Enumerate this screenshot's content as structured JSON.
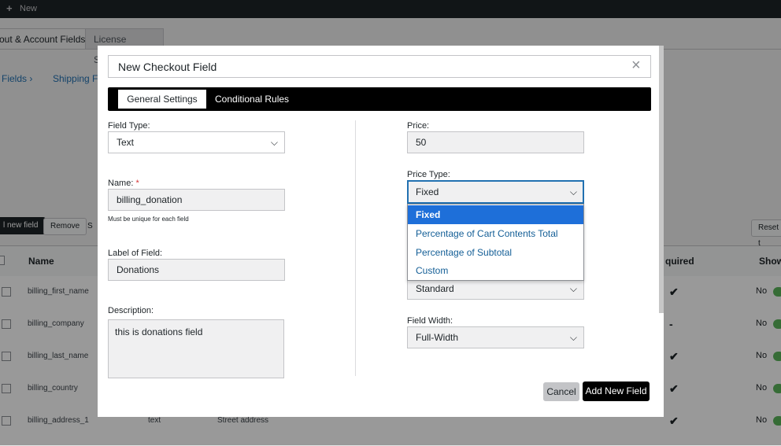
{
  "admin_bar": {
    "new_label": "New"
  },
  "bg_tabs": {
    "active": "out & Account Fields",
    "license": "License Setting"
  },
  "bg_subnav": {
    "fields": "Fields ›",
    "shipping": "Shipping Fi"
  },
  "bg_toolbar": {
    "add": "l new field",
    "remove": "Remove",
    "s": "S",
    "reset": "Reset t"
  },
  "bg_table": {
    "headers": {
      "name": "Name",
      "required": "quired",
      "show": "Show"
    },
    "rows": [
      {
        "name": "billing_first_name",
        "type": "",
        "label": "",
        "required": "✔",
        "show": "No"
      },
      {
        "name": "billing_company",
        "type": "",
        "label": "",
        "required": "-",
        "show": "No"
      },
      {
        "name": "billing_last_name",
        "type": "",
        "label": "",
        "required": "✔",
        "show": "No"
      },
      {
        "name": "billing_country",
        "type": "",
        "label": "",
        "required": "✔",
        "show": "No"
      },
      {
        "name": "billing_address_1",
        "type": "text",
        "label": "Street address",
        "required": "✔",
        "show": "No"
      }
    ]
  },
  "modal": {
    "title": "New Checkout Field",
    "close": "×",
    "tabs": {
      "general": "General Settings",
      "conditional": "Conditional Rules"
    },
    "field_type": {
      "label": "Field Type:",
      "value": "Text"
    },
    "name": {
      "label": "Name:",
      "required_mark": "*",
      "value": "billing_donation",
      "help": "Must be unique for each field"
    },
    "label_of_field": {
      "label": "Label of Field:",
      "value": "Donations"
    },
    "description": {
      "label": "Description:",
      "value": "this is donations field"
    },
    "price": {
      "label": "Price:",
      "value": "50"
    },
    "price_type": {
      "label": "Price Type:",
      "value": "Fixed",
      "options": [
        "Fixed",
        "Percentage of Cart Contents Total",
        "Percentage of Subtotal",
        "Custom"
      ]
    },
    "hidden_select": {
      "value": "Standard"
    },
    "field_width": {
      "label": "Field Width:",
      "value": "Full-Width"
    },
    "buttons": {
      "cancel": "Cancel",
      "add": "Add New Field"
    }
  },
  "icons": {
    "plus": "+",
    "chevron": "⌵",
    "check": "✔"
  },
  "colors": {
    "accent": "#2271b1",
    "selected_option": "#1e6fd9",
    "dark": "#000000"
  }
}
